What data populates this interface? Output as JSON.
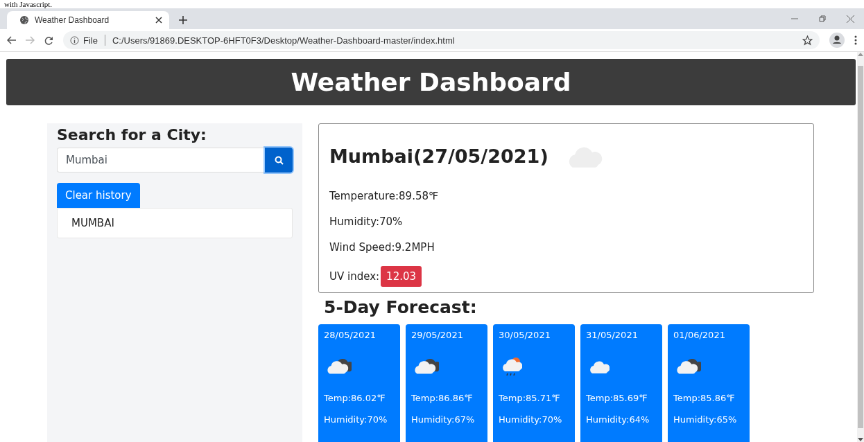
{
  "caption": "with Javascript.",
  "browser": {
    "tab_title": "Weather Dashboard",
    "url_scheme": "File",
    "url": "C:/Users/91869.DESKTOP-6HFT0F3/Desktop/Weather-Dashboard-master/index.html"
  },
  "header": {
    "title": "Weather Dashboard"
  },
  "search": {
    "heading": "Search for a City:",
    "value": "Mumbai",
    "clear_button": "Clear history",
    "history": [
      "MUMBAI"
    ]
  },
  "current": {
    "title": "Mumbai(27/05/2021)",
    "kind": "cloud-faint",
    "temperature": "Temperature:89.58℉",
    "humidity": "Humidity:70%",
    "wind": "Wind Speed:9.2MPH",
    "uv_label": "UV index:",
    "uv_value": "12.03"
  },
  "forecast": {
    "heading": "5-Day Forecast:",
    "days": [
      {
        "date": "28/05/2021",
        "kind": "broken-clouds",
        "temp": "Temp:86.02℉",
        "humidity": "Humidity:70%"
      },
      {
        "date": "29/05/2021",
        "kind": "broken-clouds",
        "temp": "Temp:86.86℉",
        "humidity": "Humidity:67%"
      },
      {
        "date": "30/05/2021",
        "kind": "rain-sun",
        "temp": "Temp:85.71℉",
        "humidity": "Humidity:70%"
      },
      {
        "date": "31/05/2021",
        "kind": "cloud",
        "temp": "Temp:85.69℉",
        "humidity": "Humidity:64%"
      },
      {
        "date": "01/06/2021",
        "kind": "broken-clouds",
        "temp": "Temp:85.86℉",
        "humidity": "Humidity:65%"
      }
    ]
  }
}
